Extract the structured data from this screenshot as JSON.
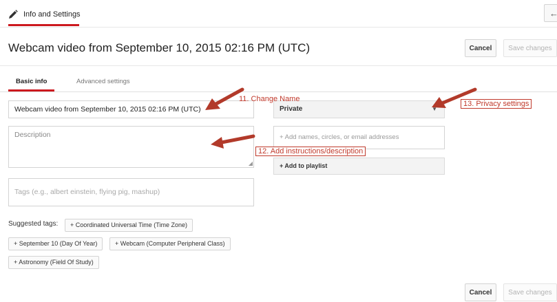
{
  "header": {
    "tab_label": "Info and Settings",
    "back_icon": "←",
    "title": "Webcam video from September 10, 2015 02:16 PM (UTC)",
    "cancel_label": "Cancel",
    "save_label": "Save changes"
  },
  "tabs": [
    {
      "label": "Basic info",
      "active": true
    },
    {
      "label": "Advanced settings",
      "active": false
    }
  ],
  "form": {
    "title_value": "Webcam video from September 10, 2015 02:16 PM (UTC)",
    "description_placeholder": "Description",
    "tags_placeholder": "Tags (e.g., albert einstein, flying pig, mashup)",
    "privacy_value": "Private",
    "share_placeholder": "+ Add names, circles, or email addresses",
    "playlist_label": "+ Add to playlist"
  },
  "suggested": {
    "label": "Suggested tags:",
    "tags": [
      "+ Coordinated Universal Time (Time Zone)",
      "+ September 10 (Day Of Year)",
      "+ Webcam (Computer Peripheral Class)",
      "+ Astronomy (Field Of Study)"
    ]
  },
  "footer": {
    "cancel_label": "Cancel",
    "save_label": "Save changes"
  },
  "annotations": {
    "change_name": "11. Change Name",
    "description": "12. Add instructions/description",
    "privacy": "13.  Privacy settings"
  },
  "colors": {
    "accent": "#cc181e",
    "annotation": "#c0392b"
  }
}
